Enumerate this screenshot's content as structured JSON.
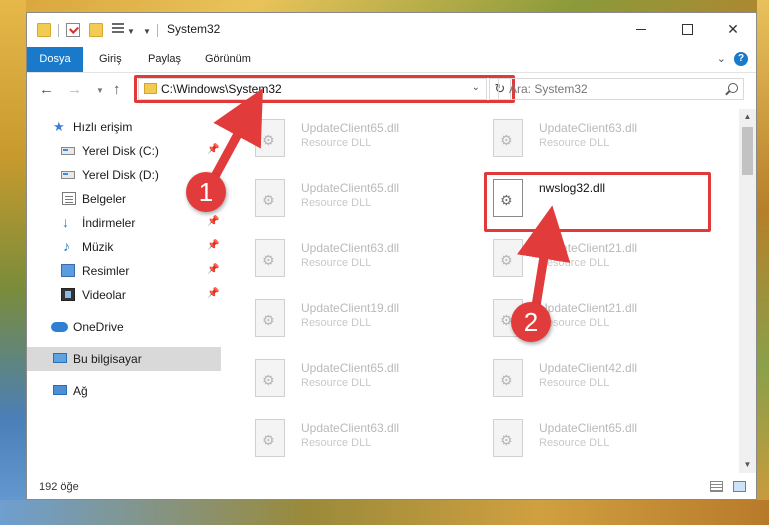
{
  "window": {
    "title": "System32",
    "minimize_label": "",
    "close_label": "✕"
  },
  "ribbon": {
    "tabs": [
      "Dosya",
      "Giriş",
      "Paylaş",
      "Görünüm"
    ],
    "help_label": "?"
  },
  "address": {
    "path": "C:\\Windows\\System32",
    "refresh_label": "↻"
  },
  "search": {
    "placeholder": "Ara: System32"
  },
  "sidebar": {
    "items": [
      {
        "label": "Hızlı erişim",
        "icon": "star-icon"
      },
      {
        "label": "Yerel Disk (C:)",
        "icon": "disk-icon",
        "pinned": true
      },
      {
        "label": "Yerel Disk (D:)",
        "icon": "disk-icon",
        "pinned": false
      },
      {
        "label": "Belgeler",
        "icon": "document-icon",
        "pinned": true
      },
      {
        "label": "İndirmeler",
        "icon": "download-icon",
        "pinned": true
      },
      {
        "label": "Müzik",
        "icon": "music-icon",
        "pinned": true
      },
      {
        "label": "Resimler",
        "icon": "pictures-icon",
        "pinned": true
      },
      {
        "label": "Videolar",
        "icon": "video-icon",
        "pinned": true
      },
      {
        "label": "OneDrive",
        "icon": "cloud-icon"
      },
      {
        "label": "Bu bilgisayar",
        "icon": "computer-icon",
        "selected": true
      },
      {
        "label": "Ağ",
        "icon": "network-icon"
      }
    ]
  },
  "files": {
    "left": [
      {
        "name": "UpdateClient65.dll",
        "type": "Resource DLL"
      },
      {
        "name": "UpdateClient65.dll",
        "type": "Resource DLL"
      },
      {
        "name": "UpdateClient63.dll",
        "type": "Resource DLL"
      },
      {
        "name": "UpdateClient19.dll",
        "type": "Resource DLL"
      },
      {
        "name": "UpdateClient65.dll",
        "type": "Resource DLL"
      },
      {
        "name": "UpdateClient63.dll",
        "type": "Resource DLL"
      }
    ],
    "right": [
      {
        "name": "UpdateClient63.dll",
        "type": "Resource DLL"
      },
      {
        "name": "nwslog32.dll",
        "type": "",
        "highlighted": true
      },
      {
        "name": "UpdateClient21.dll",
        "type": "Resource DLL"
      },
      {
        "name": "UpdateClient21.dll",
        "type": "Resource DLL"
      },
      {
        "name": "UpdateClient42.dll",
        "type": "Resource DLL"
      },
      {
        "name": "UpdateClient65.dll",
        "type": "Resource DLL"
      }
    ]
  },
  "status": {
    "item_count": "192 öğe"
  },
  "annotations": {
    "badge_1": "1",
    "badge_2": "2",
    "color": "#e23b3b"
  },
  "colors": {
    "accent": "#1979ca",
    "highlight": "#e0393a"
  }
}
